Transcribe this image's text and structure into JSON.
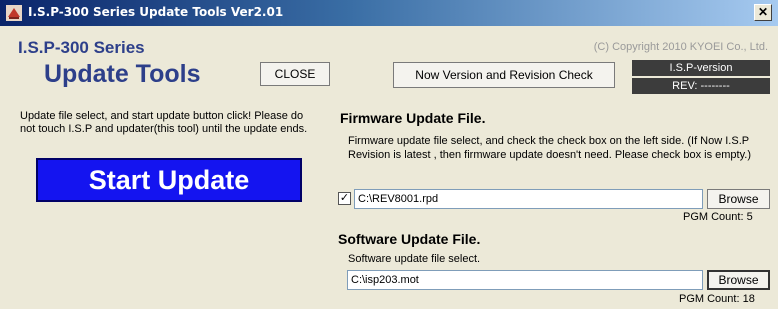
{
  "window": {
    "title": "I.S.P-300 Series Update Tools Ver2.01",
    "close_glyph": "✕",
    "app_icon": "app-icon"
  },
  "header": {
    "series": "I.S.P-300 Series",
    "copyright": "(C) Copyright 2010  KYOEI  Co., Ltd.",
    "update_tools": "Update Tools",
    "close_label": "CLOSE",
    "check_label": "Now Version and Revision Check",
    "isp_version": "I.S.P-version",
    "rev": "REV: --------"
  },
  "left": {
    "notice": "Update file select, and start update button click! Please do not touch I.S.P and updater(this tool) until the update ends.",
    "start_label": "Start Update"
  },
  "firmware": {
    "title": "Firmware Update File.",
    "desc": "Firmware update file select, and check the check box on the left side. (If Now I.S.P Revision is latest , then firmware update doesn't need. Please check box is empty.)",
    "checked": true,
    "check_glyph": "✓",
    "path": "C:\\REV8001.rpd",
    "browse_label": "Browse",
    "pgm_count": "PGM Count:   5"
  },
  "software": {
    "title": "Software Update File.",
    "desc": "Software update file select.",
    "path": "C:\\isp203.mot",
    "browse_label": "Browse",
    "pgm_count": "PGM Count:   18"
  }
}
